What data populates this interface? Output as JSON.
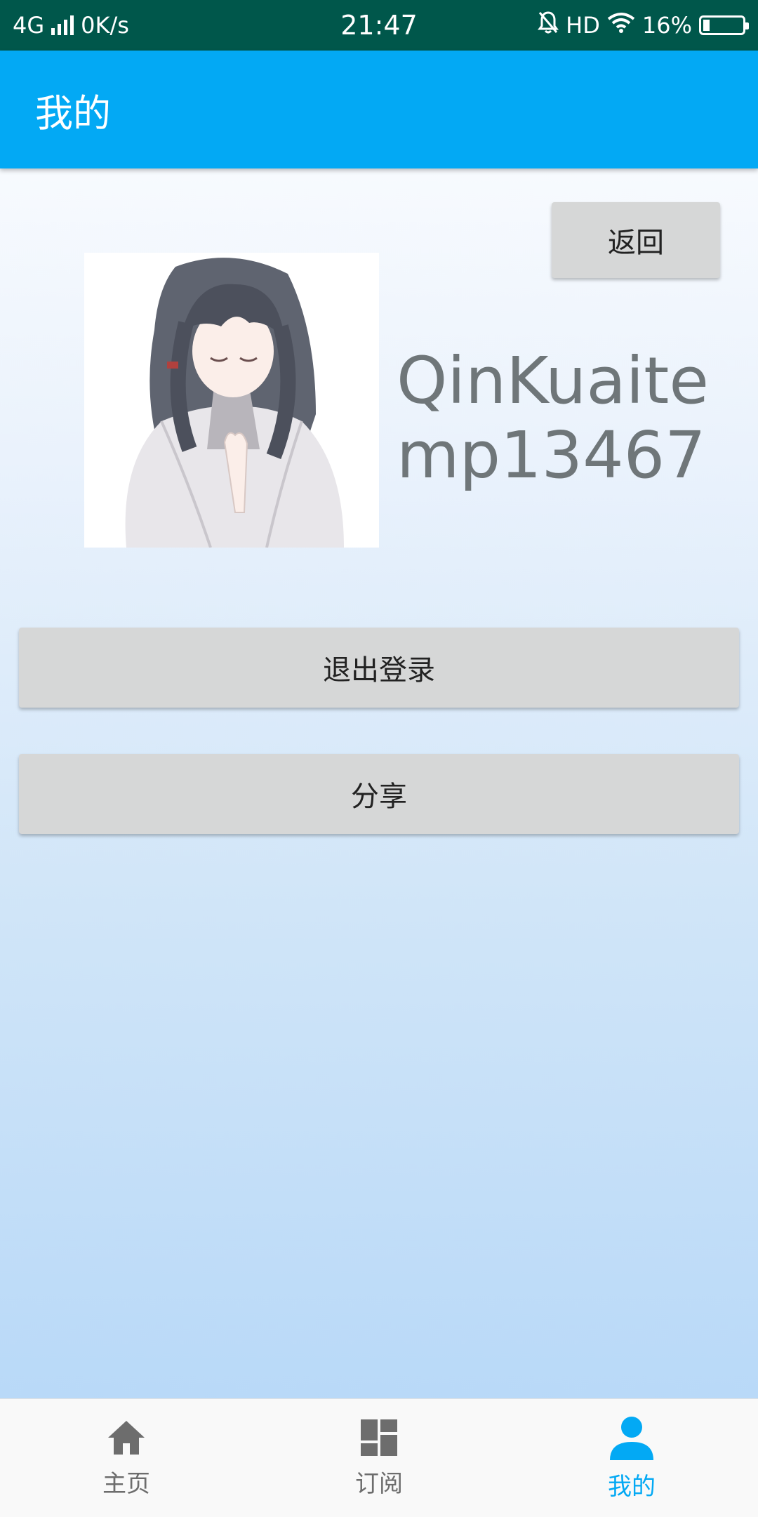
{
  "status_bar": {
    "network": "4G",
    "speed": "0K/s",
    "time": "21:47",
    "hd": "HD",
    "battery": "16%",
    "battery_level": 0.16
  },
  "app_bar": {
    "title": "我的"
  },
  "profile": {
    "back_label": "返回",
    "username": "QinKuaitemp13467"
  },
  "actions": {
    "logout_label": "退出登录",
    "share_label": "分享"
  },
  "bottom_nav": {
    "items": [
      {
        "label": "主页",
        "icon": "home-icon",
        "active": false
      },
      {
        "label": "订阅",
        "icon": "dashboard-icon",
        "active": false
      },
      {
        "label": "我的",
        "icon": "person-icon",
        "active": true
      }
    ]
  },
  "colors": {
    "accent": "#03a9f4",
    "status_bar": "#00574b",
    "button": "#d6d7d7"
  }
}
